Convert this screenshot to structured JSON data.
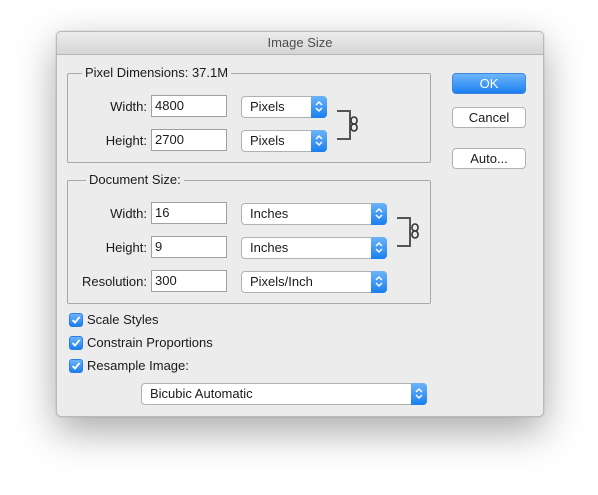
{
  "window": {
    "title": "Image Size"
  },
  "pixel_dimensions": {
    "legend": "Pixel Dimensions:",
    "size": "37.1M",
    "width_label": "Width:",
    "width_value": "4800",
    "width_unit": "Pixels",
    "height_label": "Height:",
    "height_value": "2700",
    "height_unit": "Pixels"
  },
  "document_size": {
    "legend": "Document Size:",
    "width_label": "Width:",
    "width_value": "16",
    "width_unit": "Inches",
    "height_label": "Height:",
    "height_value": "9",
    "height_unit": "Inches",
    "resolution_label": "Resolution:",
    "resolution_value": "300",
    "resolution_unit": "Pixels/Inch"
  },
  "options": {
    "scale_styles": {
      "label": "Scale Styles",
      "checked": true
    },
    "constrain_proportions": {
      "label": "Constrain Proportions",
      "checked": true
    },
    "resample_image": {
      "label": "Resample Image:",
      "checked": true
    },
    "resample_method": "Bicubic Automatic"
  },
  "buttons": {
    "ok": "OK",
    "cancel": "Cancel",
    "auto": "Auto..."
  },
  "colors": {
    "accent": "#1a7ff0",
    "window_bg": "#ececec",
    "border": "#a8a8a8"
  },
  "icons": [
    "link-chain-icon",
    "up-down-arrows-icon",
    "checkmark-icon"
  ]
}
